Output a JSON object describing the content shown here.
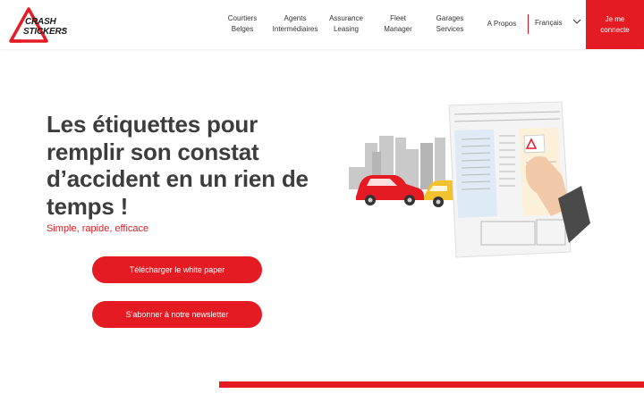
{
  "logo": {
    "line1": "CRASH",
    "line2": "STICKERS",
    "reg": "®"
  },
  "nav": {
    "items": [
      {
        "label": "Courtiers\nBelges"
      },
      {
        "label": "Agents\nIntermédiaires"
      },
      {
        "label": "Assurance\nLeasing"
      },
      {
        "label": "Fleet\nManager"
      },
      {
        "label": "Garages\nServices"
      },
      {
        "label": "A Propos"
      }
    ],
    "language": "Français",
    "login": "Je me\nconnecte"
  },
  "hero": {
    "title": "Les étiquettes pour remplir son constat d’accident en un rien de temps !",
    "subtitle": "Simple, rapide, efficace",
    "btn_whitepaper": "Télécharger le white paper",
    "btn_newsletter": "S'abonner à notre newsletter"
  },
  "colors": {
    "brand_red": "#e41b23",
    "text_dark": "#3d3d3d"
  },
  "icons": {
    "language_chevron": "chevron-down-icon"
  }
}
